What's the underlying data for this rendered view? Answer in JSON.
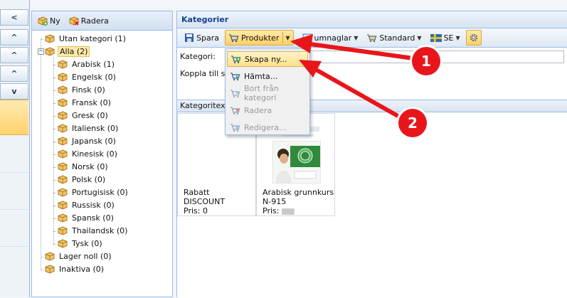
{
  "leftstrip": {
    "buttons": [
      "<",
      "^",
      "^",
      "^",
      "v"
    ]
  },
  "tree": {
    "new_label": "Ny",
    "delete_label": "Radera",
    "nodes": [
      {
        "label": "Utan kategori (1)"
      },
      {
        "label": "Alla (2)"
      },
      {
        "label": "Arabisk (1)"
      },
      {
        "label": "Engelsk (0)"
      },
      {
        "label": "Finsk (0)"
      },
      {
        "label": "Fransk (0)"
      },
      {
        "label": "Gresk (0)"
      },
      {
        "label": "Italiensk (0)"
      },
      {
        "label": "Japansk (0)"
      },
      {
        "label": "Kinesisk (0)"
      },
      {
        "label": "Norsk (0)"
      },
      {
        "label": "Polsk (0)"
      },
      {
        "label": "Portugisisk (0)"
      },
      {
        "label": "Russisk (0)"
      },
      {
        "label": "Spansk (0)"
      },
      {
        "label": "Thailandsk (0)"
      },
      {
        "label": "Tysk (0)"
      },
      {
        "label": "Lager noll (0)"
      },
      {
        "label": "Inaktiva (0)"
      }
    ]
  },
  "main": {
    "title": "Kategorier",
    "toolbar": {
      "save": "Spara",
      "products": "Produkter",
      "thumbnails_partial": "umnaglar",
      "standard": "Standard",
      "language": "SE"
    },
    "form": {
      "category_label": "Kategori:",
      "link_label_partial": "Koppla till sid"
    },
    "section_label": "Kategoritext",
    "products": [
      {
        "name": "Rabatt",
        "code": "DISCOUNT",
        "price_label": "Pris: 0"
      },
      {
        "name": "Arabisk grunnkurs",
        "code": "N-915",
        "price_label": "Pris:"
      }
    ]
  },
  "dropdown": {
    "items": [
      {
        "label": "Skapa ny...",
        "enabled": true,
        "highlighted": true
      },
      {
        "label": "Hämta...",
        "enabled": true,
        "highlighted": false
      },
      {
        "label": "Bort från kategori",
        "enabled": false,
        "highlighted": false
      },
      {
        "label": "Radera",
        "enabled": false,
        "highlighted": false
      },
      {
        "label": "Redigera...",
        "enabled": false,
        "highlighted": false
      }
    ]
  },
  "annotations": {
    "badge1": "1",
    "badge2": "2",
    "color": "#e8161b"
  }
}
